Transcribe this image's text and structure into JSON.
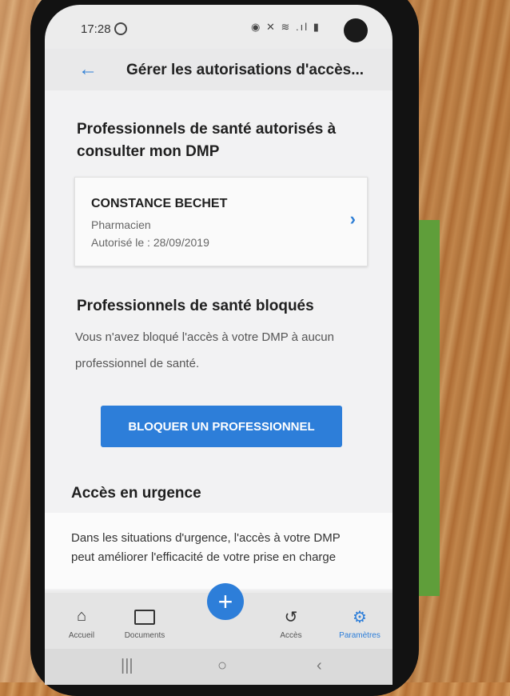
{
  "status_bar": {
    "time": "17:28",
    "icons_text": "◉ ✕ ≋ .ıl ▮"
  },
  "app_bar": {
    "back_icon": "arrow-left-icon",
    "title": "Gérer les autorisations d'accès..."
  },
  "authorized_section": {
    "title_line1": "Professionnels de santé autorisés à",
    "title_line2": "consulter mon DMP",
    "items": [
      {
        "name": "CONSTANCE BECHET",
        "role": "Pharmacien",
        "date": "Autorisé le : 28/09/2019"
      }
    ]
  },
  "blocked_section": {
    "title": "Professionnels de santé bloqués",
    "text_line1": "Vous n'avez bloqué l'accès à votre DMP à aucun",
    "text_line2": "professionnel de santé.",
    "button_label": "BLOQUER UN PROFESSIONNEL"
  },
  "urgence_section": {
    "title": "Accès en urgence",
    "text_line1": "Dans les situations d'urgence, l'accès à votre DMP",
    "text_line2": "peut améliorer l'efficacité de votre prise en charge"
  },
  "bottom_nav": {
    "fab_label": "+",
    "items": [
      {
        "label": "Accueil",
        "icon": "home-icon",
        "active": false
      },
      {
        "label": "Documents",
        "icon": "folder-icon",
        "active": false
      },
      {
        "label": "Accès",
        "icon": "history-icon",
        "active": false
      },
      {
        "label": "Paramètres",
        "icon": "gear-icon",
        "active": true
      }
    ]
  },
  "colors": {
    "accent": "#2d7ed9",
    "text_dark": "#1f1f1f",
    "text_muted": "#666666"
  }
}
